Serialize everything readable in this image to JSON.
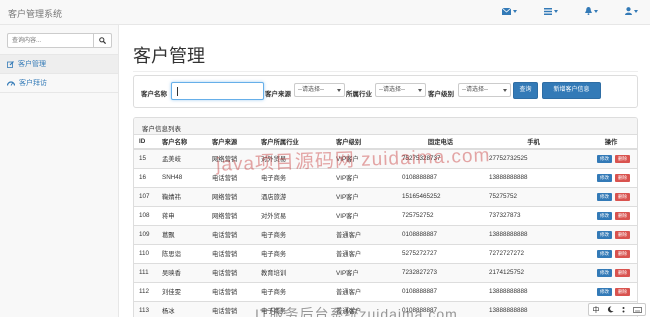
{
  "navbar": {
    "brand": "客户管理系统",
    "icons": [
      "envelope-icon",
      "tasks-icon",
      "bell-icon",
      "user-icon"
    ]
  },
  "sidebar": {
    "search_placeholder": "查询内容...",
    "items": [
      {
        "label": "客户管理",
        "icon": "edit-icon",
        "active": true
      },
      {
        "label": "客户拜访",
        "icon": "dashboard-icon",
        "active": false
      }
    ]
  },
  "main": {
    "title": "客户管理",
    "filter": {
      "name_label": "客户名称",
      "name_value": "",
      "source_label": "客户来源",
      "source_select": "--请选择--",
      "industry_label": "所属行业",
      "industry_select": "--请选择--",
      "level_label": "客户级别",
      "level_select": "--请选择--",
      "query_button": "查询",
      "add_button": "新增客户信息"
    },
    "list": {
      "heading": "客户信息列表",
      "columns": [
        "ID",
        "客户名称",
        "客户来源",
        "客户所属行业",
        "客户级别",
        "固定电话",
        "手机",
        "操作"
      ],
      "edit_label": "修改",
      "delete_label": "删除",
      "rows": [
        {
          "id": "15",
          "name": "孟美岐",
          "source": "网络营销",
          "industry": "对外贸易",
          "level": "VIP客户",
          "phone": "75275328737",
          "mobile": "27752732525"
        },
        {
          "id": "16",
          "name": "SNH48",
          "source": "电话营销",
          "industry": "电子商务",
          "level": "VIP客户",
          "phone": "0108888887",
          "mobile": "13888888888"
        },
        {
          "id": "107",
          "name": "鞠婧祎",
          "source": "网络营销",
          "industry": "酒店旅游",
          "level": "VIP客户",
          "phone": "15165465252",
          "mobile": "75275752"
        },
        {
          "id": "108",
          "name": "蒋申",
          "source": "网络营销",
          "industry": "对外贸易",
          "level": "VIP客户",
          "phone": "725752752",
          "mobile": "737327873"
        },
        {
          "id": "109",
          "name": "葛飘",
          "source": "电话营销",
          "industry": "电子商务",
          "level": "普通客户",
          "phone": "0108888887",
          "mobile": "13888888888"
        },
        {
          "id": "110",
          "name": "陈思诣",
          "source": "电话营销",
          "industry": "电子商务",
          "level": "普通客户",
          "phone": "5275272727",
          "mobile": "7272727272"
        },
        {
          "id": "111",
          "name": "吴映香",
          "source": "电话营销",
          "industry": "教育培训",
          "level": "VIP客户",
          "phone": "7232827273",
          "mobile": "2174125752"
        },
        {
          "id": "112",
          "name": "刘佳雯",
          "source": "电话营销",
          "industry": "电子商务",
          "level": "普通客户",
          "phone": "0108888887",
          "mobile": "13888888888"
        },
        {
          "id": "113",
          "name": "杨冰",
          "source": "电话营销",
          "industry": "电子商务",
          "level": "普通客户",
          "phone": "0108888887",
          "mobile": "13888888888"
        }
      ]
    }
  },
  "watermark": {
    "text": "java项目源码网 zuidaima.com",
    "bottom_text": "IT服务后台系统zuidaima.com"
  },
  "ime_bar": {
    "text": "中"
  }
}
